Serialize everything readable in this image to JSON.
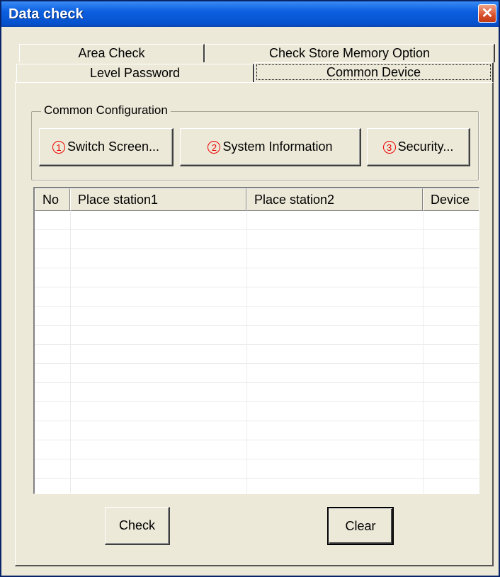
{
  "window": {
    "title": "Data check",
    "close_symbol": "✕"
  },
  "tabs": [
    {
      "label": "Area Check"
    },
    {
      "label": "Check Store Memory Option"
    },
    {
      "label": "Level Password"
    },
    {
      "label": "Common Device",
      "selected": true
    }
  ],
  "group": {
    "label": "Common Configuration",
    "buttons": [
      {
        "marker": "1",
        "label": "Switch Screen..."
      },
      {
        "marker": "2",
        "label": "System Information"
      },
      {
        "marker": "3",
        "label": "Security..."
      }
    ]
  },
  "table": {
    "columns": [
      "No",
      "Place station1",
      "Place station2",
      "Device"
    ],
    "rows": []
  },
  "actions": {
    "check_label": "Check",
    "clear_label": "Clear"
  },
  "colors": {
    "title_bar": "#0b5fe0",
    "background": "#ece9d8",
    "marker": "#e00000"
  }
}
